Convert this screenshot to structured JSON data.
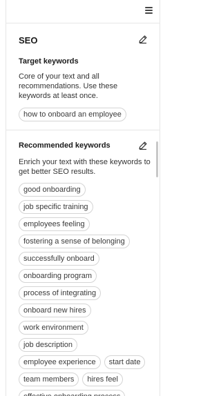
{
  "header": {
    "menu_icon": "hamburger-menu-icon"
  },
  "seo": {
    "title": "SEO",
    "edit_icon": "pencil-icon",
    "target": {
      "title": "Target keywords",
      "description": "Core of your text and all recommendations. Use these keywords at least once.",
      "keywords": [
        "how to onboard an employee"
      ]
    },
    "recommended": {
      "title": "Recommended keywords",
      "edit_icon": "pencil-icon",
      "description": "Enrich your text with these keywords to get better SEO results.",
      "keywords": [
        "good onboarding",
        "job specific training",
        "employees feeling",
        "fostering a sense of belonging",
        "successfully onboard",
        "onboarding program",
        "process of integrating",
        "onboard new hires",
        "work environment",
        "job description",
        "employee experience",
        "start date",
        "team members",
        "hires feel",
        "effective onboarding process"
      ]
    }
  }
}
